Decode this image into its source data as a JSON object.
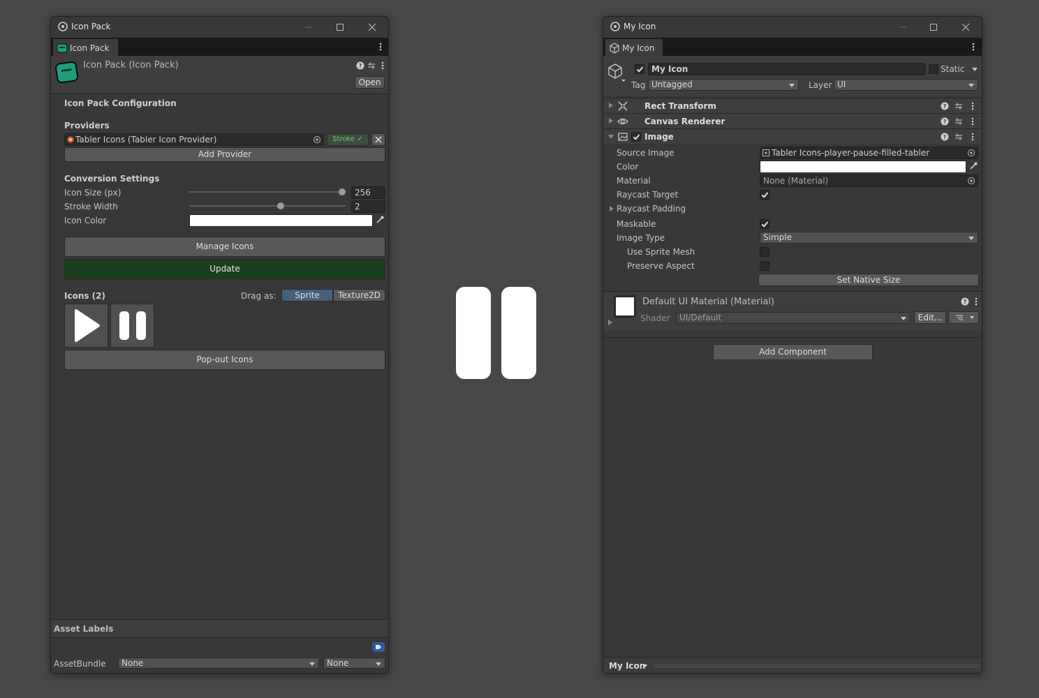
{
  "left_window": {
    "title": "Icon Pack",
    "tab_label": "Icon Pack",
    "asset_header": {
      "title": "Icon Pack (Icon Pack)",
      "open_label": "Open"
    },
    "config_title": "Icon Pack Configuration",
    "providers": {
      "title": "Providers",
      "items": [
        {
          "label": "Tabler Icons (Tabler Icon Provider)",
          "badge": "Stroke ✓"
        }
      ],
      "add_label": "Add Provider"
    },
    "conversion": {
      "title": "Conversion Settings",
      "icon_size_label": "Icon Size (px)",
      "icon_size_value": "256",
      "icon_size_fraction": 1.0,
      "stroke_width_label": "Stroke Width",
      "stroke_width_value": "2",
      "stroke_width_fraction": 0.59,
      "icon_color_label": "Icon Color",
      "icon_color": "#ffffff"
    },
    "manage_label": "Manage Icons",
    "update_label": "Update",
    "icons": {
      "title": "Icons (2)",
      "drag_as_label": "Drag as:",
      "options": [
        "Sprite",
        "Texture2D"
      ],
      "selected": "Sprite",
      "items": [
        "player-play-icon",
        "player-pause-icon"
      ]
    },
    "popout_label": "Pop-out Icons",
    "asset_labels": {
      "title": "Asset Labels",
      "assetbundle_label": "AssetBundle",
      "bundle_value": "None",
      "variant_value": "None"
    }
  },
  "preview": {
    "icon": "player-pause-filled-icon",
    "color": "#ffffff"
  },
  "right_window": {
    "title": "My Icon",
    "tab_label": "My Icon",
    "gameobject": {
      "active": true,
      "name": "My Icon",
      "static_label": "Static",
      "static_checked": false,
      "tag_label": "Tag",
      "tag_value": "Untagged",
      "layer_label": "Layer",
      "layer_value": "UI"
    },
    "components": {
      "rect_transform": "Rect Transform",
      "canvas_renderer": "Canvas Renderer",
      "image": "Image"
    },
    "image": {
      "source_image_label": "Source Image",
      "source_image_value": "Tabler Icons-player-pause-filled-tabler",
      "color_label": "Color",
      "color_value": "#ffffff",
      "material_label": "Material",
      "material_value": "None (Material)",
      "raycast_target_label": "Raycast Target",
      "raycast_target": true,
      "raycast_padding_label": "Raycast Padding",
      "maskable_label": "Maskable",
      "maskable": true,
      "image_type_label": "Image Type",
      "image_type_value": "Simple",
      "use_sprite_mesh_label": "Use Sprite Mesh",
      "use_sprite_mesh": false,
      "preserve_aspect_label": "Preserve Aspect",
      "preserve_aspect": false,
      "set_native_size_label": "Set Native Size"
    },
    "material_block": {
      "title": "Default UI Material (Material)",
      "shader_label": "Shader",
      "shader_value": "UI/Default",
      "edit_label": "Edit..."
    },
    "add_component_label": "Add Component",
    "footer_label": "My Icon"
  },
  "colors": {
    "accent_green": "#1b3e1e",
    "selected_blue": "#46607c",
    "provider_badge_green": "#6fce6f",
    "teal_icon": "#1f9c7a"
  }
}
